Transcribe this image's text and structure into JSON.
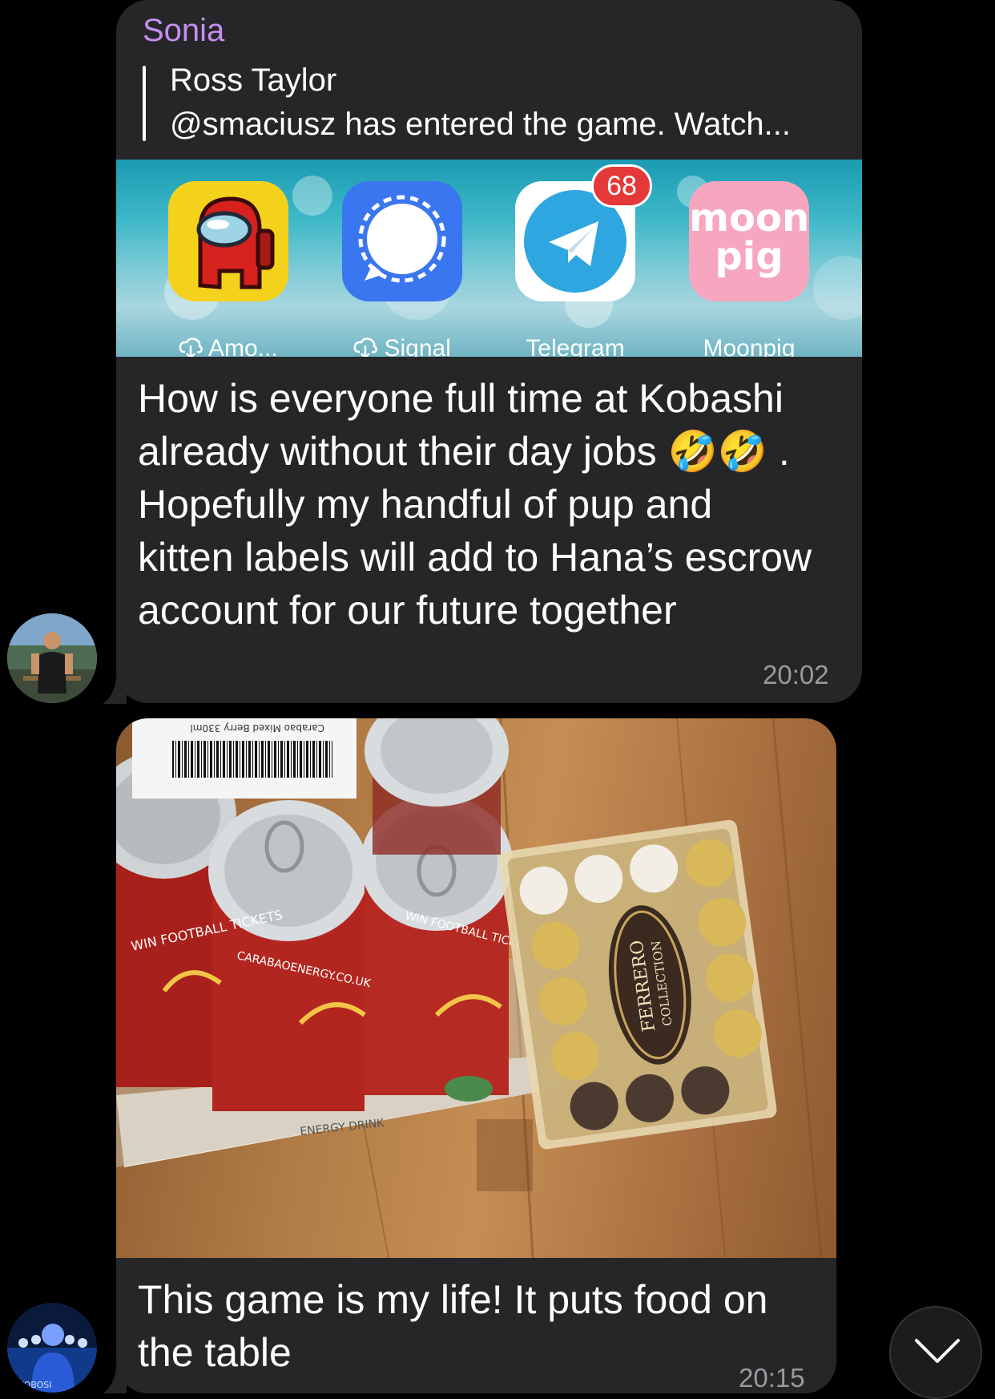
{
  "message1": {
    "sender": "Sonia",
    "reply": {
      "author": "Ross Taylor",
      "text": "@smaciusz has entered the game. Watch..."
    },
    "apps": [
      {
        "label": "Amo...",
        "icon": "among-us-icon",
        "cloud": true
      },
      {
        "label": "Signal",
        "icon": "signal-icon",
        "cloud": true
      },
      {
        "label": "Telegram",
        "icon": "telegram-icon",
        "cloud": false,
        "badge": "68"
      },
      {
        "label": "Moonpig",
        "icon": "moonpig-icon",
        "cloud": false
      }
    ],
    "moonpig_logo_line1": "moon",
    "moonpig_logo_line2": "pig",
    "text": "How is everyone full time at Kobashi already without their day jobs 🤣🤣 . Hopefully my handful of pup and kitten labels will add to Hana’s escrow account for our future together",
    "time": "20:02"
  },
  "message2": {
    "photo": {
      "label_text": "Carabao Mixed Berry 330ml",
      "can_print": "WIN FOOTBALL TICKETS",
      "website": "CARABAOENERGY.CO.UK",
      "tray_print": "ENERGY DRINK",
      "chocolate_brand": "FERRERO",
      "chocolate_line": "COLLECTION"
    },
    "text": "This game is my life! It puts food on the table",
    "time": "20:15"
  },
  "colors": {
    "background": "#000000",
    "bubble": "#262628",
    "sender": "#c48ff0",
    "time": "#9a9a9e"
  }
}
